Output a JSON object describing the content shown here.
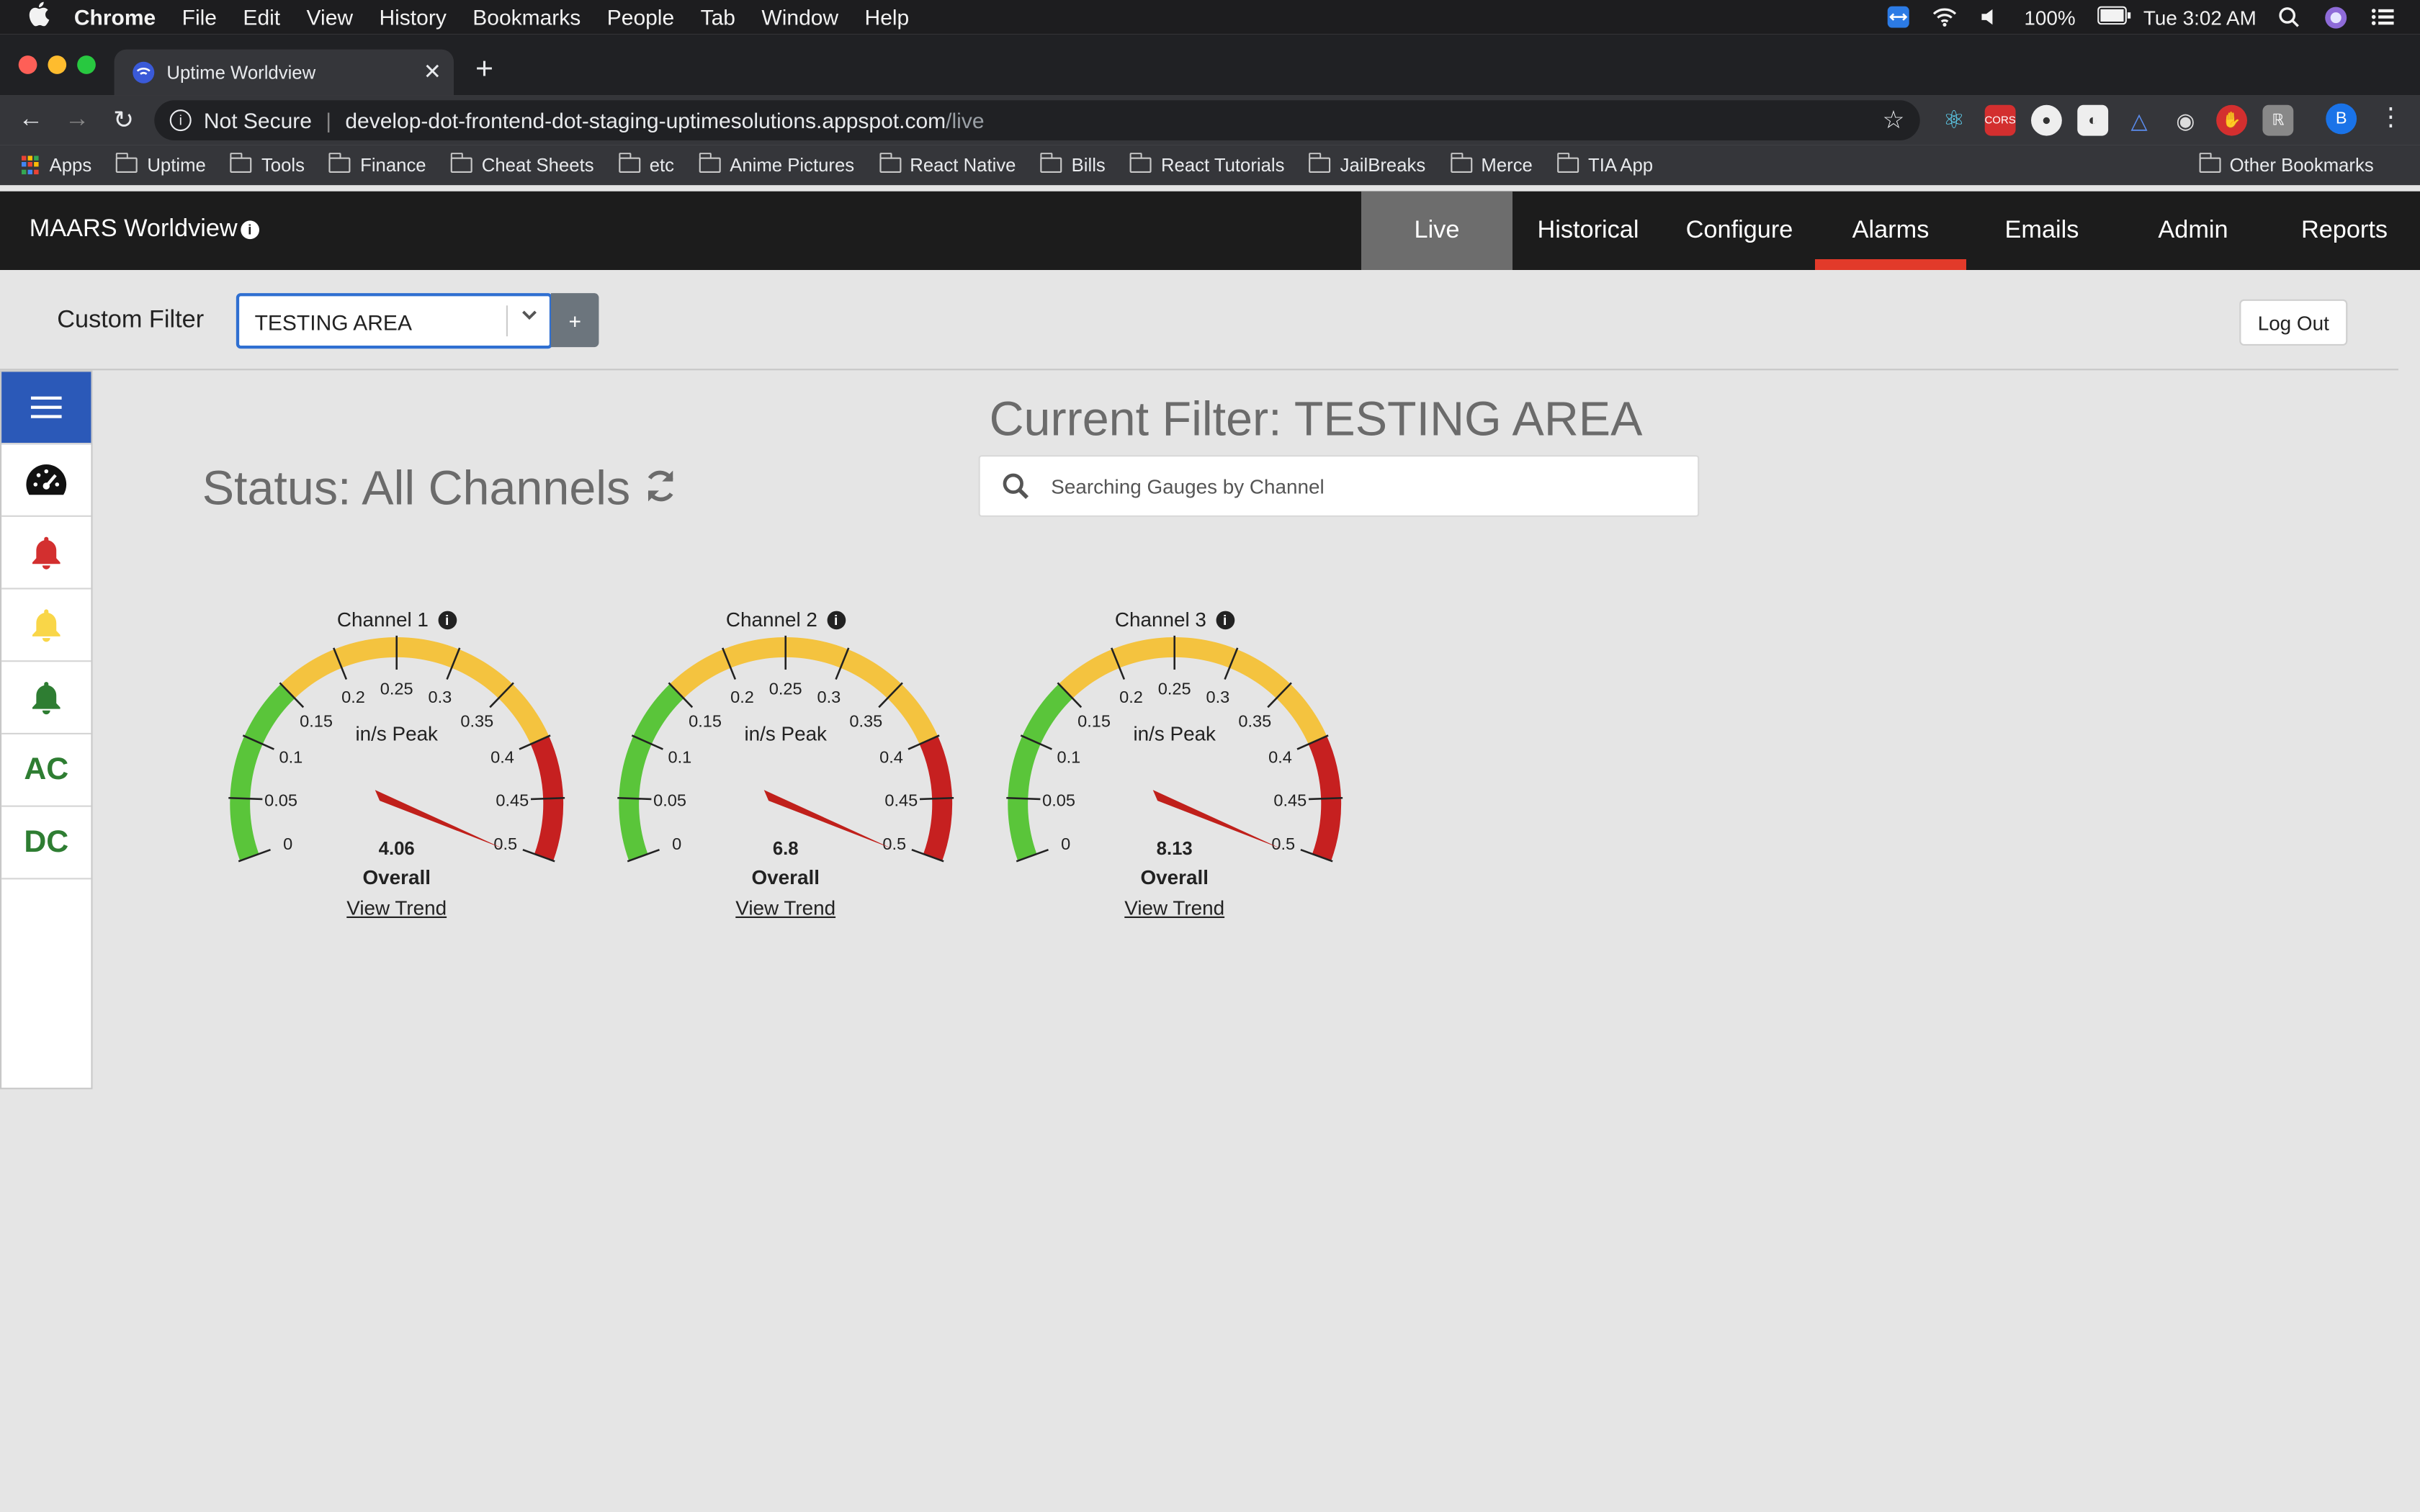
{
  "mac_menubar": {
    "app": "Chrome",
    "items": [
      "File",
      "Edit",
      "View",
      "History",
      "Bookmarks",
      "People",
      "Tab",
      "Window",
      "Help"
    ],
    "battery": "100%",
    "clock": "Tue 3:02 AM"
  },
  "browser": {
    "tab_title": "Uptime Worldview",
    "security_label": "Not Secure",
    "url_host": "develop-dot-frontend-dot-staging-uptimesolutions.appspot.com",
    "url_path": "/live",
    "profile_initial": "B",
    "bookmarks": [
      "Apps",
      "Uptime",
      "Tools",
      "Finance",
      "Cheat Sheets",
      "etc",
      "Anime Pictures",
      "React Native",
      "Bills",
      "React Tutorials",
      "JailBreaks",
      "Merce",
      "TIA App"
    ],
    "other_bookmarks": "Other Bookmarks"
  },
  "app": {
    "brand": "MAARS Worldview",
    "nav": [
      "Live",
      "Historical",
      "Configure",
      "Alarms",
      "Emails",
      "Admin",
      "Reports"
    ],
    "active_nav": "Live",
    "alarm_color": "#e23a2a",
    "filter_label": "Custom Filter",
    "filter_value": "TESTING AREA",
    "add_filter_label": "+",
    "logout_label": "Log Out",
    "sidebar": {
      "menu_icon": "hamburger-icon",
      "items": [
        "gauge-icon",
        "bell-red-icon",
        "bell-yellow-icon",
        "bell-green-icon"
      ],
      "ac_label": "AC",
      "dc_label": "DC",
      "colors": {
        "menu_bg": "#2b59b8",
        "red": "#d32f2f",
        "yellow": "#f9d648",
        "green": "#2e7d32"
      }
    },
    "current_filter_title": "Current Filter: TESTING AREA",
    "status_title": "Status: All Channels",
    "search_placeholder": "Searching Gauges by Channel"
  },
  "gauges": {
    "units_label": "in/s Peak",
    "overall_label": "Overall",
    "trend_label": "View Trend",
    "ticks": [
      "0",
      "0.05",
      "0.1",
      "0.15",
      "0.2",
      "0.25",
      "0.3",
      "0.35",
      "0.4",
      "0.45",
      "0.5"
    ],
    "zone_colors": {
      "green": "#5ac53a",
      "yellow": "#f4c33f",
      "red": "#c62020"
    },
    "channels": [
      {
        "name": "Channel 1",
        "value": "4.06"
      },
      {
        "name": "Channel 2",
        "value": "6.8"
      },
      {
        "name": "Channel 3",
        "value": "8.13"
      }
    ]
  }
}
